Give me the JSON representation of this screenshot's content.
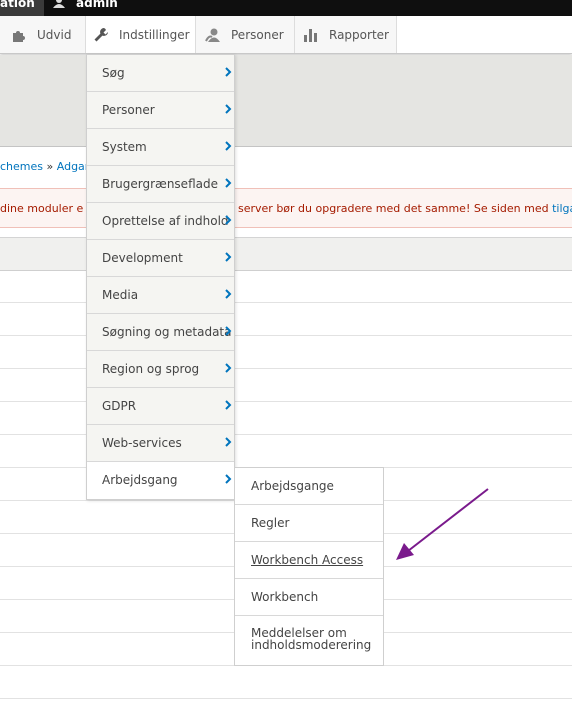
{
  "topbar": {
    "site_name": "ation",
    "user": "admin"
  },
  "toolbar": {
    "items": [
      {
        "label": "Udvid",
        "icon": "puzzle-icon"
      },
      {
        "label": "Indstillinger",
        "icon": "wrench-icon"
      },
      {
        "label": "Personer",
        "icon": "person-icon"
      },
      {
        "label": "Rapporter",
        "icon": "bar-chart-icon"
      }
    ]
  },
  "breadcrumb": {
    "part1": "chemes",
    "sep": " » ",
    "part2": "Adgan"
  },
  "message": {
    "text_left": "dine moduler e",
    "text_right": "server bør du opgradere med det samme! Se siden med ",
    "link": "tilga"
  },
  "menu": {
    "items": [
      {
        "label": "Søg"
      },
      {
        "label": "Personer"
      },
      {
        "label": "System"
      },
      {
        "label": "Brugergrænseflade"
      },
      {
        "label": "Oprettelse af indhold"
      },
      {
        "label": "Development"
      },
      {
        "label": "Media"
      },
      {
        "label": "Søgning og metadata"
      },
      {
        "label": "Region og sprog"
      },
      {
        "label": "GDPR"
      },
      {
        "label": "Web-services"
      },
      {
        "label": "Arbejdsgang"
      }
    ]
  },
  "submenu": {
    "items": [
      {
        "label": "Arbejdsgange"
      },
      {
        "label": "Regler"
      },
      {
        "label": "Workbench Access"
      },
      {
        "label": "Workbench"
      },
      {
        "label": "Meddelelser om indholdsmoderering"
      }
    ]
  },
  "colors": {
    "accent": "#0074bd",
    "arrow": "#7a1a8c",
    "error_text": "#a51b00",
    "chevron": "#0074bd"
  }
}
